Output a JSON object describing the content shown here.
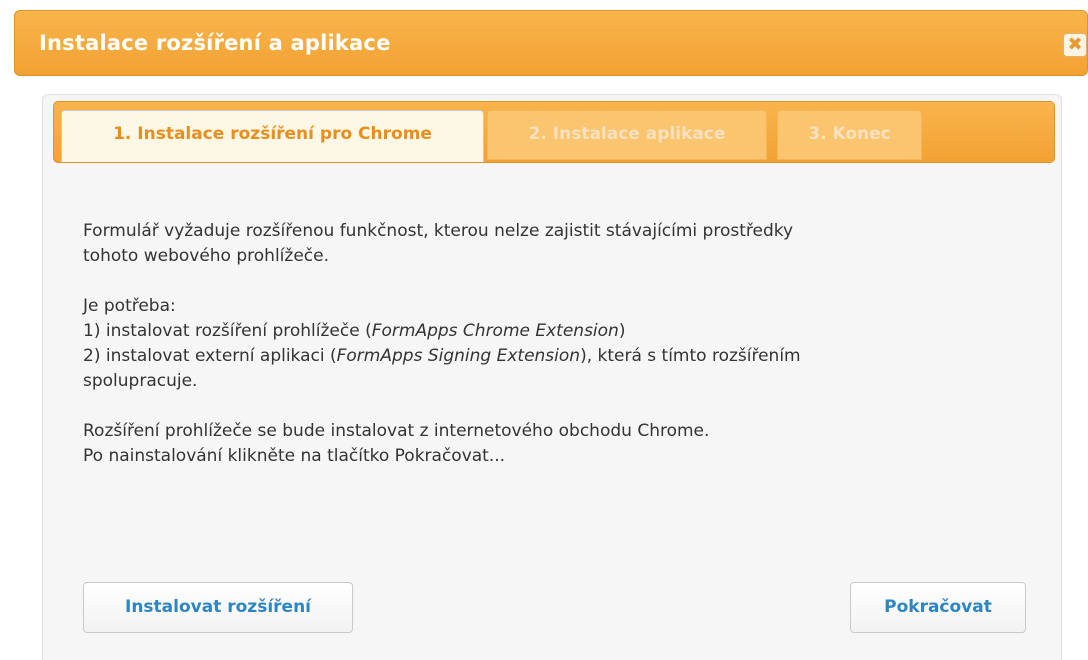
{
  "dialog": {
    "title": "Instalace rozšíření a aplikace",
    "close_icon": "close-icon",
    "close_glyph": "✖"
  },
  "tabs": [
    {
      "label": "1. Instalace rozšíření pro Chrome",
      "state": "active"
    },
    {
      "label": "2. Instalace aplikace",
      "state": "inactive"
    },
    {
      "label": "3. Konec",
      "state": "inactive"
    }
  ],
  "content": {
    "paragraph1_line1": "Formulář vyžaduje rozšířenou funkčnost, kterou nelze zajistit stávajícími prostředky",
    "paragraph1_line2": "tohoto webového prohlížeče.",
    "need_heading": "Je potřeba:",
    "step1_prefix": "1) instalovat rozšíření prohlížeče (",
    "step1_name": "FormApps Chrome Extension",
    "step1_suffix": ")",
    "step2_prefix": "2) instalovat externí aplikaci (",
    "step2_name": "FormApps Signing Extension",
    "step2_suffix": "), která s tímto rozšířením",
    "step2_line2": "spolupracuje.",
    "paragraph3_line1": "Rozšíření prohlížeče se bude instalovat z internetového obchodu Chrome.",
    "paragraph3_line2": "Po nainstalování klikněte na tlačítko Pokračovat..."
  },
  "buttons": {
    "install_label": "Instalovat rozšíření",
    "continue_label": "Pokračovat"
  },
  "colors": {
    "accent_orange": "#f2a233",
    "active_tab_text": "#e98e1c",
    "button_text": "#2e86c1",
    "body_text": "#333333"
  }
}
